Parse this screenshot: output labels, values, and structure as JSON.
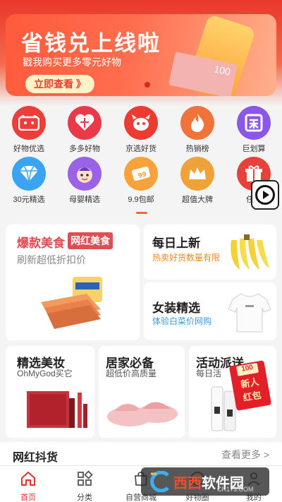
{
  "banner": {
    "title": "省钱兑上线啦",
    "subtitle": "戳我购买更多零元好物",
    "cta": "立即查看 》",
    "money_label": "100"
  },
  "categories": [
    {
      "label": "好物优选",
      "icon": "cat-face-icon",
      "color": "#ef3d3a"
    },
    {
      "label": "多多好物",
      "icon": "heart-icon",
      "color": "#ea3a4a"
    },
    {
      "label": "京选好货",
      "icon": "dog-icon",
      "color": "#ee3b32"
    },
    {
      "label": "热销榜",
      "icon": "flame-icon",
      "color": "#f0743a"
    },
    {
      "label": "巨划算",
      "icon": "ju-icon",
      "color": "#8b57e8"
    },
    {
      "label": "30元精选",
      "icon": "diamond-icon",
      "color": "#3aa3f2"
    },
    {
      "label": "母婴精选",
      "icon": "baby-icon",
      "color": "#9a62e6"
    },
    {
      "label": "9.9包邮",
      "icon": "ticket-icon",
      "color": "#f7a23a"
    },
    {
      "label": "超值大牌",
      "icon": "crown-icon",
      "color": "#f0a23a"
    },
    {
      "label": "任务",
      "icon": "gift-icon",
      "color": "#e7423a"
    }
  ],
  "sections": {
    "hot_food": {
      "title": "爆款美食",
      "tag": "网红美食",
      "subtitle": "刷新超低折扣价"
    },
    "daily_new": {
      "title": "每日上新",
      "subtitle": "热卖好货数量有限",
      "sub_color": "#f08a1c"
    },
    "women": {
      "title": "女装精选",
      "subtitle": "体验白菜价网购",
      "sub_color": "#3a9bd8"
    },
    "makeup": {
      "title": "精选美妆",
      "subtitle": "OhMyGod买它"
    },
    "home": {
      "title": "居家必备",
      "subtitle": "超低价高质量"
    },
    "activity": {
      "title": "活动派送",
      "subtitle": "每日活",
      "badge_line1": "新人",
      "badge_line2": "红包",
      "badge_amount": "100"
    }
  },
  "feed": {
    "title": "网红抖货",
    "more": "查看更多 >"
  },
  "tabs": [
    {
      "label": "首页",
      "icon": "home-icon",
      "active": true
    },
    {
      "label": "分类",
      "icon": "grid-icon",
      "active": false
    },
    {
      "label": "自营商城",
      "icon": "shop-icon",
      "active": false
    },
    {
      "label": "好物圈",
      "icon": "circle-icon",
      "active": false
    },
    {
      "label": "我的",
      "icon": "user-icon",
      "active": false
    }
  ],
  "watermark": {
    "brand": "西西",
    "name": "软件园",
    "url": "CR173.COM"
  },
  "colors": {
    "accent": "#e5302a",
    "active_tab": "#e5302a"
  }
}
